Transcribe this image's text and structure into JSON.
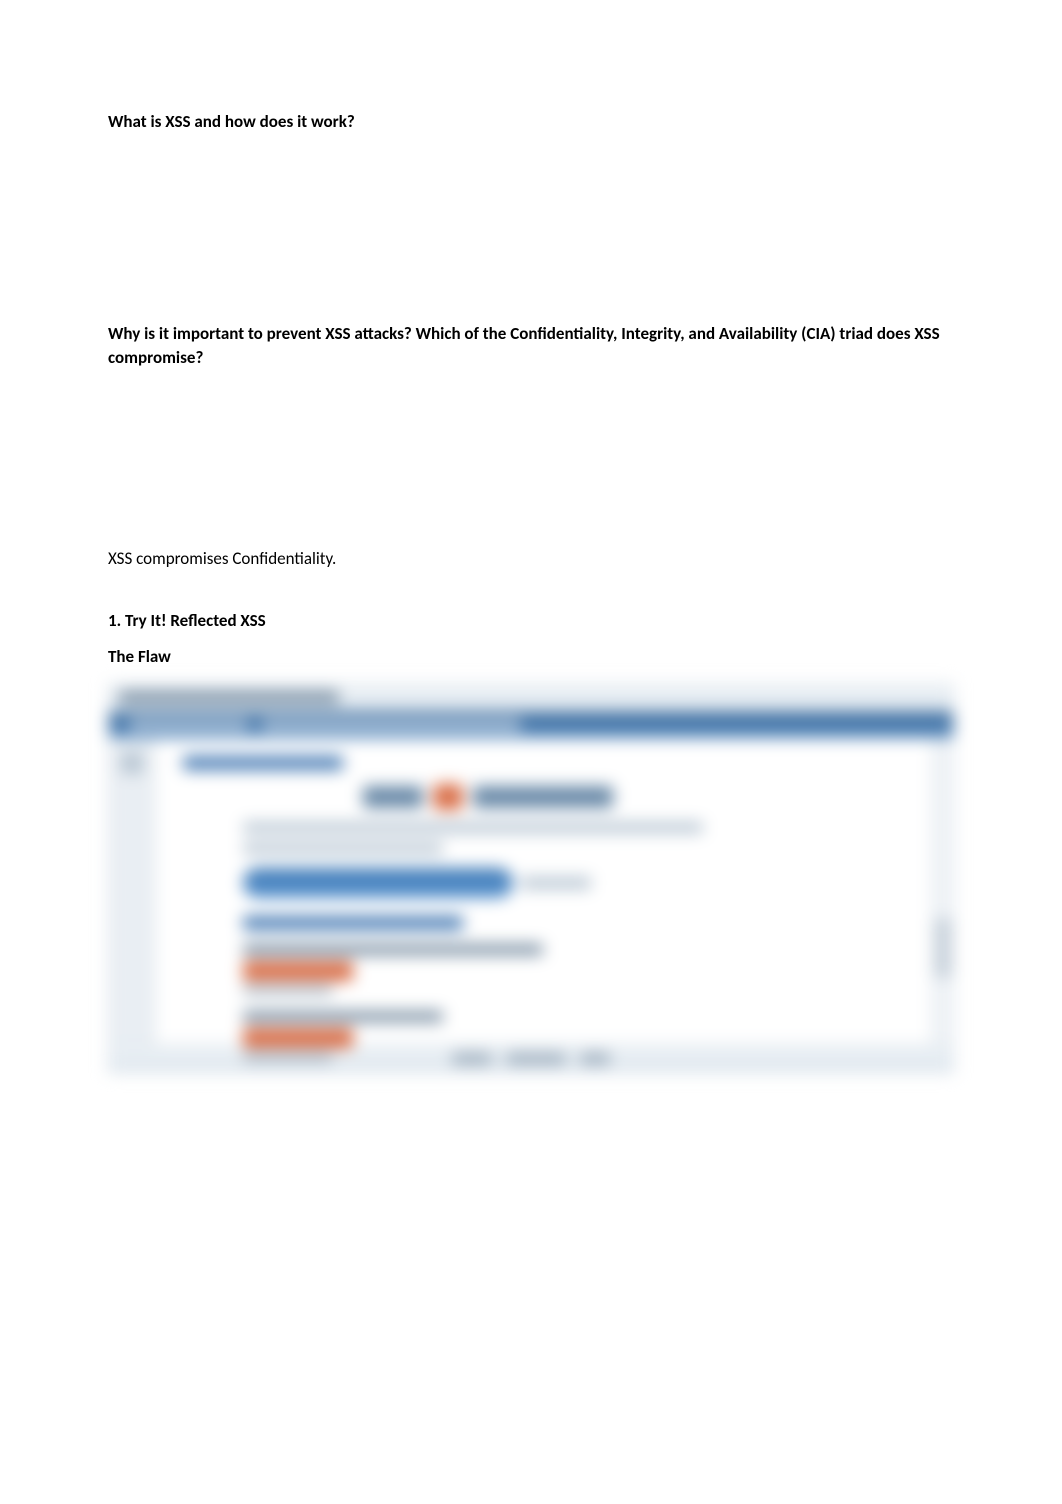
{
  "question1": "What is XSS and how does it work?",
  "question2": "Why is it important to prevent XSS attacks? Which of the Confidentiality, Integrity, and Availability (CIA) triad does XSS compromise?",
  "answer2_visible": "XSS compromises Confidentiality.",
  "section1_heading": "1. Try It! Reflected XSS",
  "section1_subheading": "The Flaw"
}
